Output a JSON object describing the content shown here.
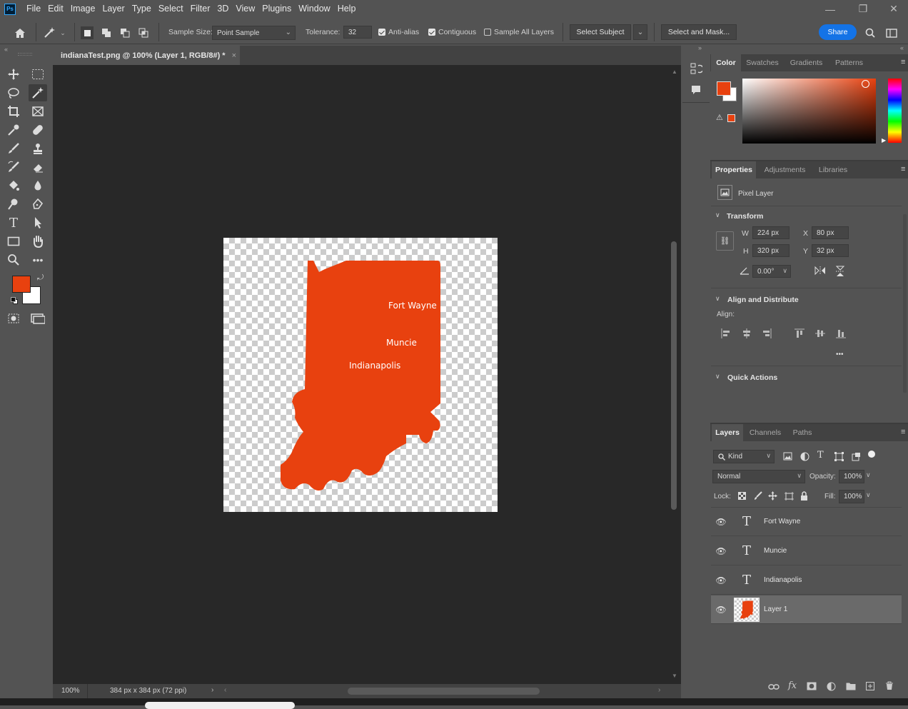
{
  "app": {
    "logo": "Ps"
  },
  "menu": [
    "File",
    "Edit",
    "Image",
    "Layer",
    "Type",
    "Select",
    "Filter",
    "3D",
    "View",
    "Plugins",
    "Window",
    "Help"
  ],
  "window_controls": {
    "minimize": "—",
    "restore": "❐",
    "close": "✕"
  },
  "options": {
    "sample_size_label": "Sample Size:",
    "sample_size_value": "Point Sample",
    "tolerance_label": "Tolerance:",
    "tolerance_value": "32",
    "antialias_label": "Anti-alias",
    "antialias_checked": true,
    "contiguous_label": "Contiguous",
    "contiguous_checked": true,
    "sample_all_layers_label": "Sample All Layers",
    "sample_all_layers_checked": false,
    "select_subject_label": "Select Subject",
    "select_and_mask_label": "Select and Mask...",
    "share_label": "Share"
  },
  "document": {
    "tab_title": "indianaTest.png @ 100% (Layer 1, RGB/8#) *",
    "tab_close": "×",
    "zoom": "100%",
    "doc_info": "384 px x 384 px (72 ppi)",
    "map_fill": "#e8410f",
    "labels": {
      "fort_wayne": "Fort Wayne",
      "muncie": "Muncie",
      "indianapolis": "Indianapolis"
    }
  },
  "colors": {
    "foreground": "#e8410f",
    "background": "#ffffff",
    "accent": "#1473e6"
  },
  "color_panel": {
    "tabs": [
      "Color",
      "Swatches",
      "Gradients",
      "Patterns"
    ]
  },
  "properties_panel": {
    "tabs": [
      "Properties",
      "Adjustments",
      "Libraries"
    ],
    "layer_type": "Pixel Layer",
    "transform_title": "Transform",
    "w_label": "W",
    "w_value": "224 px",
    "h_label": "H",
    "h_value": "320 px",
    "x_label": "X",
    "x_value": "80 px",
    "y_label": "Y",
    "y_value": "32 px",
    "angle_value": "0.00°",
    "align_title": "Align and Distribute",
    "align_label": "Align:",
    "quick_actions_title": "Quick Actions",
    "more": "•••"
  },
  "layers_panel": {
    "tabs": [
      "Layers",
      "Channels",
      "Paths"
    ],
    "kind_label": "Kind",
    "blend_mode": "Normal",
    "opacity_label": "Opacity:",
    "opacity_value": "100%",
    "lock_label": "Lock:",
    "fill_label": "Fill:",
    "fill_value": "100%",
    "layers": [
      {
        "name": "Fort Wayne",
        "type": "text"
      },
      {
        "name": "Muncie",
        "type": "text"
      },
      {
        "name": "Indianapolis",
        "type": "text"
      },
      {
        "name": "Layer 1",
        "type": "pixel",
        "selected": true
      }
    ]
  }
}
